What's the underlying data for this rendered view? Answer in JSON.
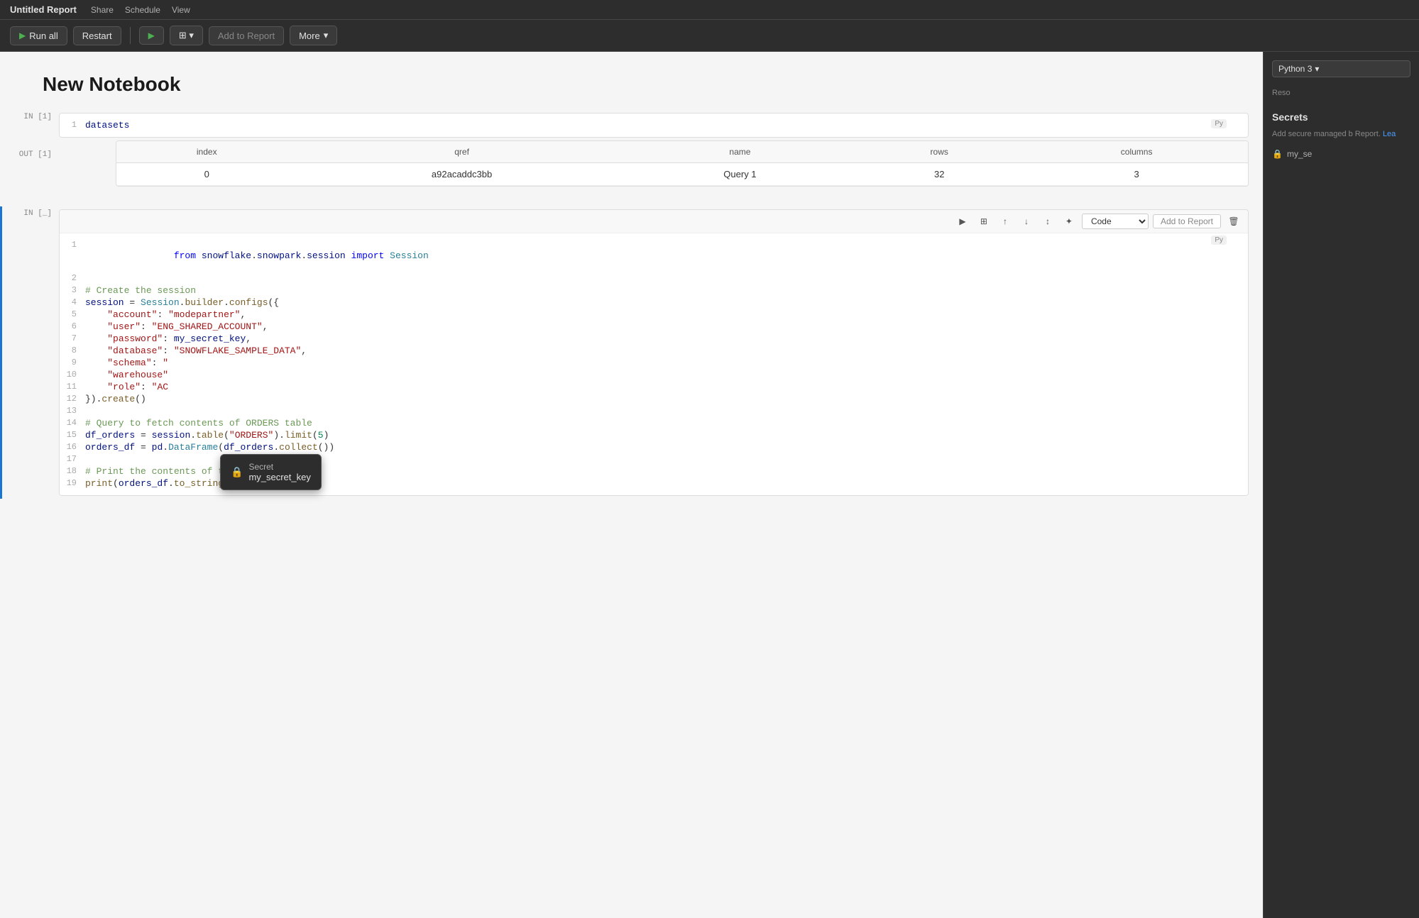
{
  "titlebar": {
    "title": "Untitled Report",
    "menu_items": [
      "Share",
      "Schedule",
      "View"
    ]
  },
  "toolbar": {
    "run_all_label": "Run all",
    "restart_label": "Restart",
    "add_report_label": "Add to Report",
    "more_label": "More"
  },
  "notebook": {
    "title": "New Notebook"
  },
  "cell1": {
    "in_label": "IN [1]",
    "out_label": "OUT [1]",
    "line_num": "1",
    "code": "datasets",
    "py_badge": "Py",
    "table": {
      "headers": [
        "index",
        "qref",
        "name",
        "rows",
        "columns"
      ],
      "rows": [
        [
          "0",
          "a92acaddc3bb",
          "Query 1",
          "32",
          "3"
        ]
      ]
    }
  },
  "cell2": {
    "in_label": "IN [_]",
    "py_badge": "Py",
    "code_type": "Code",
    "add_report_label": "Add to Report",
    "lines": [
      {
        "num": "1",
        "content": "from snowflake.snowpark.session import Session"
      },
      {
        "num": "2",
        "content": ""
      },
      {
        "num": "3",
        "content": "# Create the session"
      },
      {
        "num": "4",
        "content": "session = Session.builder.configs({"
      },
      {
        "num": "5",
        "content": "    \"account\": \"modepartner\","
      },
      {
        "num": "6",
        "content": "    \"user\": \"ENG_SHARED_ACCOUNT\","
      },
      {
        "num": "7",
        "content": "    \"password\": my_secret_key,"
      },
      {
        "num": "8",
        "content": "    \"database\": \"SNOWFLAKE_SAMPLE_DATA\","
      },
      {
        "num": "9",
        "content": "    \"schema\": \""
      },
      {
        "num": "10",
        "content": "    \"warehouse\""
      },
      {
        "num": "11",
        "content": "    \"role\": \"AC"
      },
      {
        "num": "12",
        "content": "}).create()"
      },
      {
        "num": "13",
        "content": ""
      },
      {
        "num": "14",
        "content": "# Query to fetch contents of ORDERS table"
      },
      {
        "num": "15",
        "content": "df_orders = session.table(\"ORDERS\").limit(5)"
      },
      {
        "num": "16",
        "content": "orders_df = pd.DataFrame(df_orders.collect())"
      },
      {
        "num": "17",
        "content": ""
      },
      {
        "num": "18",
        "content": "# Print the contents of the table"
      },
      {
        "num": "19",
        "content": "print(orders_df.to_string())"
      }
    ]
  },
  "right_panel": {
    "python_label": "Python 3",
    "resource_label": "Reso",
    "secrets_title": "Secrets",
    "secrets_desc": "Add secure managed b Report.",
    "secrets_link": "Lea",
    "secret_item": "my_se"
  },
  "tooltip": {
    "label": "Secret",
    "value": "my_secret_key"
  }
}
